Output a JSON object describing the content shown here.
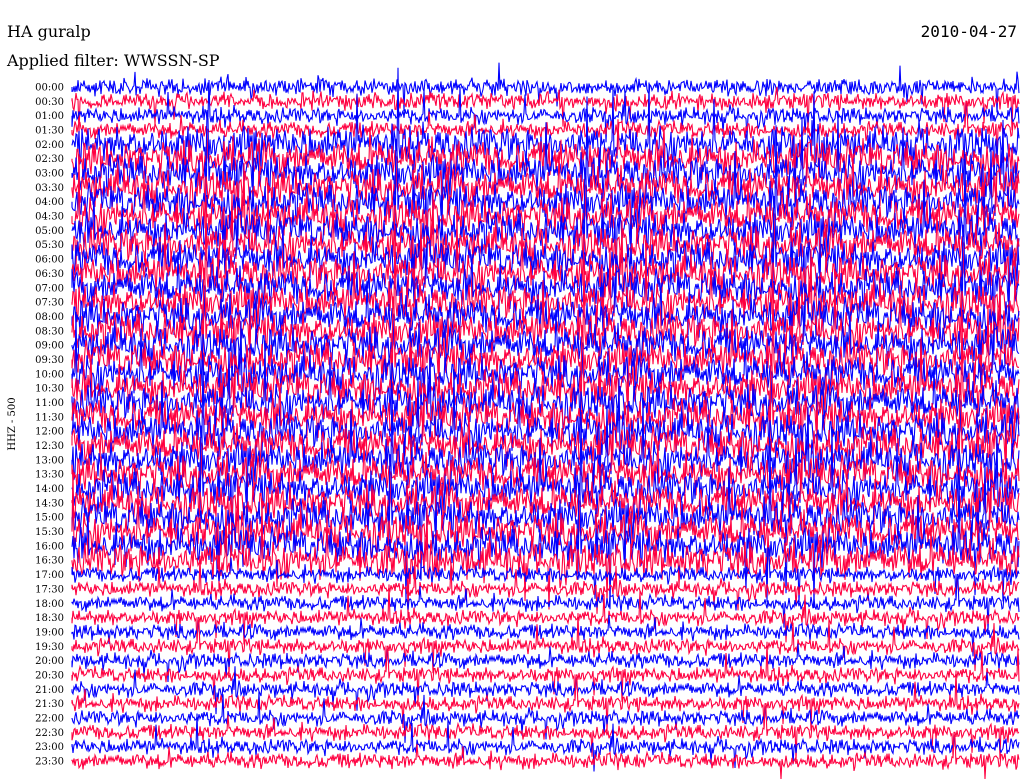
{
  "header": {
    "station": "HA guralp",
    "date": "2010-04-27",
    "filter": "Applied filter: WWSSN-SP"
  },
  "chart_data": {
    "type": "line",
    "title": "HA guralp",
    "subtitle": "Applied filter: WWSSN-SP",
    "date": "2010-04-27",
    "ylabel": "HHZ - 500",
    "xlabel": "",
    "y_tick_labels": [
      "00:00",
      "00:30",
      "01:00",
      "01:30",
      "02:00",
      "02:30",
      "03:00",
      "03:30",
      "04:00",
      "04:30",
      "05:00",
      "05:30",
      "06:00",
      "06:30",
      "07:00",
      "07:30",
      "08:00",
      "08:30",
      "09:00",
      "09:30",
      "10:00",
      "10:30",
      "11:00",
      "11:30",
      "12:00",
      "12:30",
      "13:00",
      "13:30",
      "14:00",
      "14:30",
      "15:00",
      "15:30",
      "16:00",
      "16:30",
      "17:00",
      "17:30",
      "18:00",
      "18:30",
      "19:00",
      "19:30",
      "20:00",
      "20:30",
      "21:00",
      "21:30",
      "22:00",
      "22:30",
      "23:00",
      "23:30"
    ],
    "series_colors": [
      "#0000ff",
      "#ff0040"
    ],
    "grid": false,
    "legend": "none"
  }
}
